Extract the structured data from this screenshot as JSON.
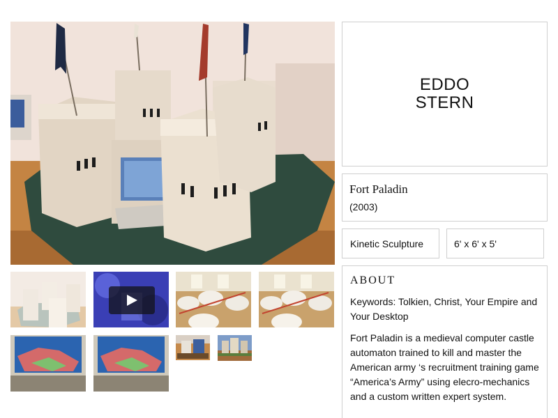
{
  "artist": {
    "name_line1": "EDDO",
    "name_line2": "STERN"
  },
  "work": {
    "title": "Fort Paladin",
    "year": "(2003)",
    "medium": "Kinetic Sculpture",
    "dimensions": "6' x 6' x 5'"
  },
  "about": {
    "heading": "ABOUT",
    "keywords": "Keywords: Tolkien, Christ, Your Empire and Your Desktop",
    "description": "Fort Paladin is a medieval computer castle automaton trained to kill and master the American army ‘s recruitment training game “America’s Army” using elecro-mechanics and a custom written expert system."
  },
  "gallery": {
    "thumbnails": [
      {
        "subject": "castle overview (faded)",
        "kind": "image"
      },
      {
        "subject": "game video",
        "kind": "video"
      },
      {
        "subject": "castle towers top view",
        "kind": "image"
      },
      {
        "subject": "castle towers top view",
        "kind": "image"
      },
      {
        "subject": "screen with desktop",
        "kind": "image"
      },
      {
        "subject": "screen with desktop",
        "kind": "image"
      },
      {
        "subject": "castle small",
        "kind": "image"
      },
      {
        "subject": "castle small exterior",
        "kind": "image"
      }
    ]
  },
  "colors": {
    "border": "#cfcfcf",
    "text": "#111111",
    "castle": "#e8dccb",
    "floor": "#c07f3f",
    "mat": "#2e4a3d"
  }
}
